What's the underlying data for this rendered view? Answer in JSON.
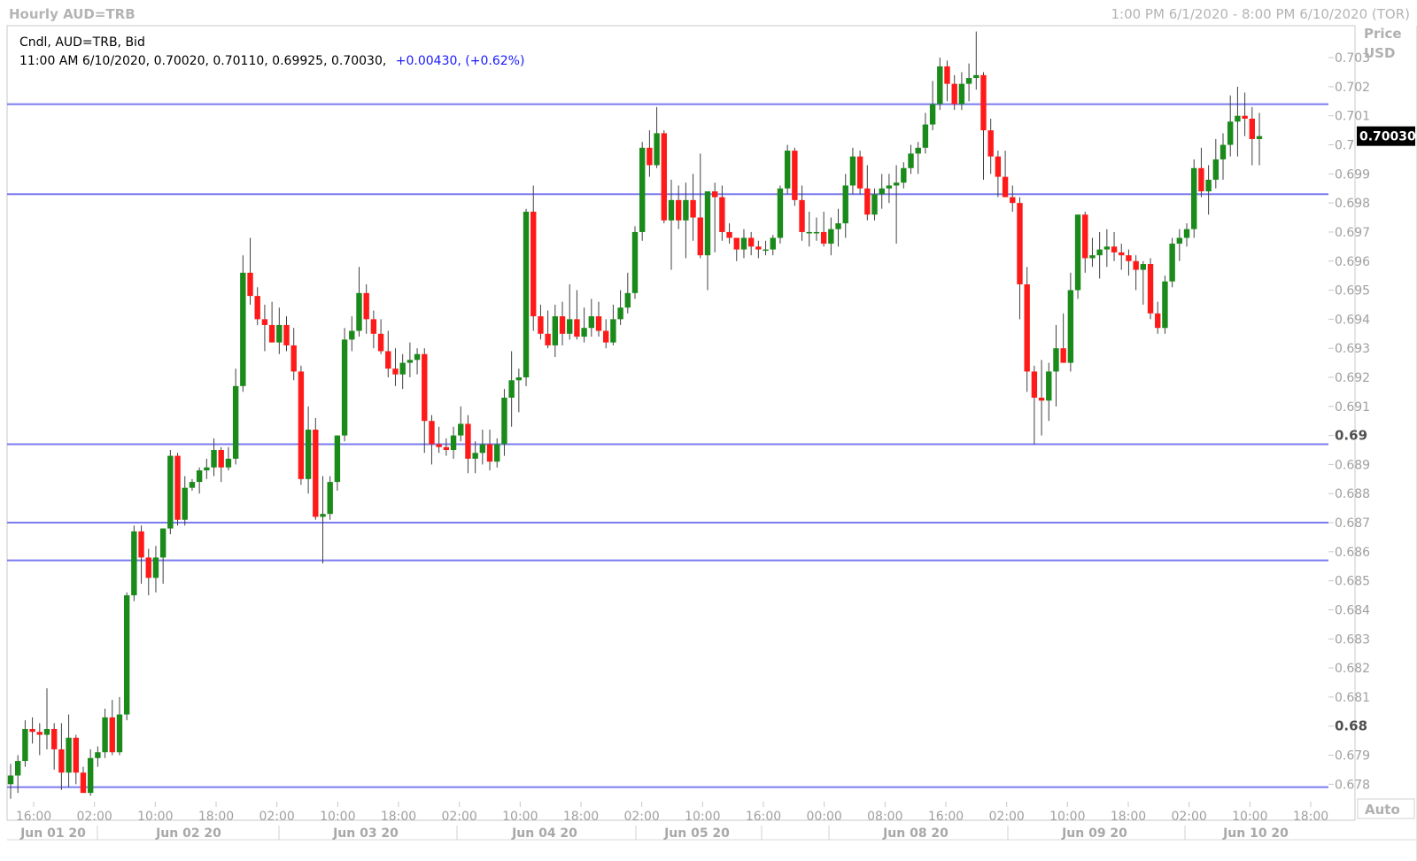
{
  "header": {
    "title": "Hourly AUD=TRB",
    "range": "1:00 PM 6/1/2020 - 8:00 PM 6/10/2020 (TOR)"
  },
  "legend": {
    "line1": "Cndl, AUD=TRB, Bid",
    "ohlc": "11:00 AM 6/10/2020, 0.70020, 0.70110, 0.69925, 0.70030,",
    "change": "+0.00430, (+0.62%)"
  },
  "price_axis": {
    "header_line1": "Price",
    "header_line2": "USD",
    "auto_label": "Auto",
    "last_price_label": "0.70030"
  },
  "colors": {
    "up": "#1a8a1a",
    "down": "#ff1a1a",
    "wick": "#404040",
    "hline": "#7b7bf0",
    "frame": "#c8c8c8"
  },
  "chart_data": {
    "type": "candlestick",
    "instrument": "AUD=TRB",
    "frequency": "Hourly",
    "ylim": [
      0.6774,
      0.7041
    ],
    "y_ticks": [
      {
        "v": 0.703,
        "label": "0.703"
      },
      {
        "v": 0.702,
        "label": "0.702"
      },
      {
        "v": 0.701,
        "label": "0.701"
      },
      {
        "v": 0.7,
        "label": "0.7"
      },
      {
        "v": 0.699,
        "label": "0.699"
      },
      {
        "v": 0.698,
        "label": "0.698"
      },
      {
        "v": 0.697,
        "label": "0.697"
      },
      {
        "v": 0.696,
        "label": "0.696"
      },
      {
        "v": 0.695,
        "label": "0.695"
      },
      {
        "v": 0.694,
        "label": "0.694"
      },
      {
        "v": 0.693,
        "label": "0.693"
      },
      {
        "v": 0.692,
        "label": "0.692"
      },
      {
        "v": 0.691,
        "label": "0.691"
      },
      {
        "v": 0.69,
        "label": "0.69",
        "bold": true
      },
      {
        "v": 0.689,
        "label": "0.689"
      },
      {
        "v": 0.688,
        "label": "0.688"
      },
      {
        "v": 0.687,
        "label": "0.687"
      },
      {
        "v": 0.686,
        "label": "0.686"
      },
      {
        "v": 0.685,
        "label": "0.685"
      },
      {
        "v": 0.684,
        "label": "0.684"
      },
      {
        "v": 0.683,
        "label": "0.683"
      },
      {
        "v": 0.682,
        "label": "0.682"
      },
      {
        "v": 0.681,
        "label": "0.681"
      },
      {
        "v": 0.68,
        "label": "0.68",
        "bold": true
      },
      {
        "v": 0.679,
        "label": "0.679"
      },
      {
        "v": 0.678,
        "label": "0.678"
      }
    ],
    "time_ticks": [
      "16:00",
      "02:00",
      "10:00",
      "18:00",
      "02:00",
      "10:00",
      "18:00",
      "02:00",
      "10:00",
      "18:00",
      "02:00",
      "10:00",
      "16:00",
      "00:00",
      "08:00",
      "16:00",
      "02:00",
      "10:00",
      "18:00",
      "02:00",
      "10:00",
      "18:00"
    ],
    "date_labels": [
      "Jun 01 20",
      "Jun 02 20",
      "Jun 03 20",
      "Jun 04 20",
      "Jun 05 20",
      "Jun 08 20",
      "Jun 09 20",
      "Jun 10 20"
    ],
    "horizontal_lines": [
      0.7014,
      0.6983,
      0.6897,
      0.687,
      0.6857,
      0.6779
    ],
    "candles": [
      [
        0.678,
        0.6787,
        0.6775,
        0.6783
      ],
      [
        0.6783,
        0.679,
        0.6777,
        0.6788
      ],
      [
        0.6788,
        0.6802,
        0.6786,
        0.6799
      ],
      [
        0.6799,
        0.6803,
        0.6794,
        0.6798
      ],
      [
        0.6798,
        0.6801,
        0.679,
        0.6797
      ],
      [
        0.6797,
        0.6813,
        0.6792,
        0.6799
      ],
      [
        0.6799,
        0.6801,
        0.6785,
        0.6792
      ],
      [
        0.6792,
        0.6801,
        0.6778,
        0.6784
      ],
      [
        0.6784,
        0.6804,
        0.6779,
        0.6796
      ],
      [
        0.6796,
        0.6797,
        0.678,
        0.6784
      ],
      [
        0.6784,
        0.6786,
        0.6777,
        0.6777
      ],
      [
        0.6777,
        0.6792,
        0.6776,
        0.6789
      ],
      [
        0.6789,
        0.6793,
        0.6786,
        0.6791
      ],
      [
        0.6791,
        0.6806,
        0.6789,
        0.6803
      ],
      [
        0.6803,
        0.6809,
        0.679,
        0.6791
      ],
      [
        0.6791,
        0.681,
        0.679,
        0.6804
      ],
      [
        0.6804,
        0.6846,
        0.6802,
        0.6845
      ],
      [
        0.6845,
        0.6869,
        0.6843,
        0.6867
      ],
      [
        0.6867,
        0.6869,
        0.6849,
        0.6858
      ],
      [
        0.6858,
        0.6861,
        0.6845,
        0.6851
      ],
      [
        0.6851,
        0.6862,
        0.6846,
        0.6858
      ],
      [
        0.6858,
        0.6868,
        0.6849,
        0.6868
      ],
      [
        0.6868,
        0.6895,
        0.6866,
        0.6893
      ],
      [
        0.6893,
        0.6894,
        0.6869,
        0.6871
      ],
      [
        0.6871,
        0.6886,
        0.6869,
        0.6882
      ],
      [
        0.6882,
        0.6885,
        0.6881,
        0.6884
      ],
      [
        0.6884,
        0.6889,
        0.688,
        0.6888
      ],
      [
        0.6888,
        0.6892,
        0.6885,
        0.6889
      ],
      [
        0.6889,
        0.6899,
        0.6886,
        0.6895
      ],
      [
        0.6895,
        0.6896,
        0.6884,
        0.6889
      ],
      [
        0.6889,
        0.6896,
        0.6888,
        0.6892
      ],
      [
        0.6892,
        0.6923,
        0.689,
        0.6917
      ],
      [
        0.6917,
        0.6962,
        0.6915,
        0.6956
      ],
      [
        0.6956,
        0.6968,
        0.6945,
        0.6948
      ],
      [
        0.6948,
        0.6951,
        0.6938,
        0.694
      ],
      [
        0.694,
        0.6945,
        0.6929,
        0.6938
      ],
      [
        0.6938,
        0.6946,
        0.6932,
        0.6932
      ],
      [
        0.6932,
        0.6944,
        0.6928,
        0.6938
      ],
      [
        0.6938,
        0.6941,
        0.6929,
        0.6931
      ],
      [
        0.6931,
        0.6937,
        0.6919,
        0.6922
      ],
      [
        0.6922,
        0.6924,
        0.6883,
        0.6885
      ],
      [
        0.6885,
        0.691,
        0.688,
        0.6902
      ],
      [
        0.6902,
        0.6906,
        0.6871,
        0.6872
      ],
      [
        0.6872,
        0.6886,
        0.6856,
        0.6873
      ],
      [
        0.6873,
        0.6886,
        0.6871,
        0.6884
      ],
      [
        0.6884,
        0.69,
        0.6881,
        0.69
      ],
      [
        0.69,
        0.6937,
        0.6898,
        0.6933
      ],
      [
        0.6933,
        0.6941,
        0.6929,
        0.6936
      ],
      [
        0.6936,
        0.6958,
        0.6934,
        0.6949
      ],
      [
        0.6949,
        0.6952,
        0.6935,
        0.694
      ],
      [
        0.694,
        0.6943,
        0.693,
        0.6935
      ],
      [
        0.6935,
        0.694,
        0.6928,
        0.6929
      ],
      [
        0.6929,
        0.6936,
        0.692,
        0.6923
      ],
      [
        0.6923,
        0.693,
        0.6917,
        0.6921
      ],
      [
        0.6921,
        0.6928,
        0.6916,
        0.6925
      ],
      [
        0.6925,
        0.6932,
        0.692,
        0.6926
      ],
      [
        0.6926,
        0.693,
        0.6921,
        0.6928
      ],
      [
        0.6928,
        0.693,
        0.6894,
        0.6905
      ],
      [
        0.6905,
        0.6907,
        0.689,
        0.6897
      ],
      [
        0.6897,
        0.6903,
        0.6894,
        0.6896
      ],
      [
        0.6896,
        0.6899,
        0.6893,
        0.6895
      ],
      [
        0.6895,
        0.6903,
        0.6892,
        0.69
      ],
      [
        0.69,
        0.691,
        0.6898,
        0.6904
      ],
      [
        0.6904,
        0.6907,
        0.6887,
        0.6892
      ],
      [
        0.6892,
        0.6898,
        0.6887,
        0.6894
      ],
      [
        0.6894,
        0.6902,
        0.689,
        0.6897
      ],
      [
        0.6897,
        0.6902,
        0.6888,
        0.6891
      ],
      [
        0.6891,
        0.6899,
        0.6889,
        0.6897
      ],
      [
        0.6897,
        0.6916,
        0.6893,
        0.6913
      ],
      [
        0.6913,
        0.6929,
        0.6903,
        0.6919
      ],
      [
        0.6919,
        0.6923,
        0.6908,
        0.692
      ],
      [
        0.692,
        0.6978,
        0.6917,
        0.6977
      ],
      [
        0.6977,
        0.6986,
        0.6936,
        0.6941
      ],
      [
        0.6941,
        0.6945,
        0.6933,
        0.6935
      ],
      [
        0.6935,
        0.6943,
        0.693,
        0.6931
      ],
      [
        0.6931,
        0.6945,
        0.6927,
        0.6941
      ],
      [
        0.6941,
        0.6946,
        0.6931,
        0.6935
      ],
      [
        0.6935,
        0.6952,
        0.6933,
        0.694
      ],
      [
        0.694,
        0.695,
        0.6933,
        0.6934
      ],
      [
        0.6934,
        0.6944,
        0.6932,
        0.6937
      ],
      [
        0.6937,
        0.6947,
        0.6934,
        0.6941
      ],
      [
        0.6941,
        0.6946,
        0.6934,
        0.6936
      ],
      [
        0.6936,
        0.694,
        0.693,
        0.6932
      ],
      [
        0.6932,
        0.6945,
        0.6931,
        0.694
      ],
      [
        0.694,
        0.695,
        0.6938,
        0.6944
      ],
      [
        0.6944,
        0.6956,
        0.6942,
        0.6949
      ],
      [
        0.6949,
        0.6972,
        0.6947,
        0.697
      ],
      [
        0.697,
        0.7001,
        0.6967,
        0.6999
      ],
      [
        0.6999,
        0.7005,
        0.6989,
        0.6993
      ],
      [
        0.6993,
        0.7013,
        0.6992,
        0.7004
      ],
      [
        0.7004,
        0.7005,
        0.6973,
        0.6974
      ],
      [
        0.6974,
        0.6988,
        0.6957,
        0.6981
      ],
      [
        0.6981,
        0.6986,
        0.6971,
        0.6974
      ],
      [
        0.6974,
        0.6987,
        0.6961,
        0.6981
      ],
      [
        0.6981,
        0.699,
        0.6967,
        0.6975
      ],
      [
        0.6975,
        0.6997,
        0.6961,
        0.6962
      ],
      [
        0.6962,
        0.6983,
        0.695,
        0.6984
      ],
      [
        0.6984,
        0.6987,
        0.6963,
        0.6982
      ],
      [
        0.6982,
        0.6986,
        0.6967,
        0.697
      ],
      [
        0.697,
        0.6973,
        0.6966,
        0.6968
      ],
      [
        0.6968,
        0.6968,
        0.696,
        0.6964
      ],
      [
        0.6964,
        0.6971,
        0.6961,
        0.6968
      ],
      [
        0.6968,
        0.697,
        0.6962,
        0.6965
      ],
      [
        0.6965,
        0.6967,
        0.6961,
        0.6964
      ],
      [
        0.6964,
        0.6967,
        0.6962,
        0.6964
      ],
      [
        0.6964,
        0.6969,
        0.6962,
        0.6968
      ],
      [
        0.6968,
        0.6986,
        0.6966,
        0.6985
      ],
      [
        0.6985,
        0.7,
        0.6983,
        0.6998
      ],
      [
        0.6998,
        0.6999,
        0.6979,
        0.6981
      ],
      [
        0.6981,
        0.6986,
        0.6967,
        0.697
      ],
      [
        0.697,
        0.6977,
        0.6965,
        0.697
      ],
      [
        0.697,
        0.6975,
        0.6967,
        0.697
      ],
      [
        0.697,
        0.6977,
        0.6965,
        0.6966
      ],
      [
        0.6966,
        0.6975,
        0.6962,
        0.6971
      ],
      [
        0.6971,
        0.6978,
        0.6965,
        0.6973
      ],
      [
        0.6973,
        0.699,
        0.6968,
        0.6986
      ],
      [
        0.6986,
        0.6999,
        0.6983,
        0.6996
      ],
      [
        0.6996,
        0.6998,
        0.6983,
        0.6985
      ],
      [
        0.6985,
        0.6993,
        0.6974,
        0.6976
      ],
      [
        0.6976,
        0.6985,
        0.6974,
        0.6983
      ],
      [
        0.6983,
        0.699,
        0.6978,
        0.6985
      ],
      [
        0.6985,
        0.699,
        0.698,
        0.6986
      ],
      [
        0.6986,
        0.6993,
        0.6966,
        0.6987
      ],
      [
        0.6987,
        0.6994,
        0.6985,
        0.6992
      ],
      [
        0.6992,
        0.7,
        0.699,
        0.6997
      ],
      [
        0.6997,
        0.7001,
        0.699,
        0.6999
      ],
      [
        0.6999,
        0.7011,
        0.6997,
        0.7007
      ],
      [
        0.7007,
        0.7022,
        0.7005,
        0.7014
      ],
      [
        0.7014,
        0.703,
        0.7012,
        0.7027
      ],
      [
        0.7027,
        0.7029,
        0.7015,
        0.7021
      ],
      [
        0.7021,
        0.7024,
        0.7012,
        0.7014
      ],
      [
        0.7014,
        0.7025,
        0.7012,
        0.7021
      ],
      [
        0.7021,
        0.7028,
        0.7015,
        0.7023
      ],
      [
        0.7023,
        0.7039,
        0.7019,
        0.7024
      ],
      [
        0.7024,
        0.7025,
        0.6988,
        0.7005
      ],
      [
        0.7005,
        0.7009,
        0.699,
        0.6996
      ],
      [
        0.6996,
        0.6998,
        0.6982,
        0.6989
      ],
      [
        0.6989,
        0.6998,
        0.6985,
        0.6982
      ],
      [
        0.6982,
        0.6986,
        0.6977,
        0.698
      ],
      [
        0.698,
        0.6982,
        0.694,
        0.6952
      ],
      [
        0.6952,
        0.6958,
        0.6915,
        0.6922
      ],
      [
        0.6922,
        0.6924,
        0.6897,
        0.6913
      ],
      [
        0.6913,
        0.6926,
        0.69,
        0.6912
      ],
      [
        0.6912,
        0.6925,
        0.6905,
        0.6922
      ],
      [
        0.6922,
        0.6938,
        0.691,
        0.693
      ],
      [
        0.693,
        0.6942,
        0.6925,
        0.6925
      ],
      [
        0.6925,
        0.6956,
        0.6922,
        0.695
      ],
      [
        0.695,
        0.6976,
        0.6947,
        0.6976
      ],
      [
        0.6976,
        0.6977,
        0.6956,
        0.6961
      ],
      [
        0.6961,
        0.6968,
        0.6958,
        0.6962
      ],
      [
        0.6962,
        0.697,
        0.6954,
        0.6964
      ],
      [
        0.6964,
        0.6971,
        0.6958,
        0.6965
      ],
      [
        0.6965,
        0.697,
        0.696,
        0.6963
      ],
      [
        0.6963,
        0.6966,
        0.6957,
        0.6962
      ],
      [
        0.6962,
        0.6964,
        0.6955,
        0.696
      ],
      [
        0.696,
        0.6962,
        0.695,
        0.6957
      ],
      [
        0.6957,
        0.696,
        0.6945,
        0.6959
      ],
      [
        0.6959,
        0.6961,
        0.694,
        0.6942
      ],
      [
        0.6942,
        0.6946,
        0.6935,
        0.6937
      ],
      [
        0.6937,
        0.6955,
        0.6935,
        0.6953
      ],
      [
        0.6953,
        0.6968,
        0.6951,
        0.6966
      ],
      [
        0.6966,
        0.6971,
        0.696,
        0.6968
      ],
      [
        0.6968,
        0.6973,
        0.6965,
        0.6971
      ],
      [
        0.6971,
        0.6995,
        0.6968,
        0.6992
      ],
      [
        0.6992,
        0.6999,
        0.6982,
        0.6984
      ],
      [
        0.6984,
        0.6993,
        0.6976,
        0.6988
      ],
      [
        0.6988,
        0.7002,
        0.6985,
        0.6995
      ],
      [
        0.6995,
        0.7004,
        0.6988,
        0.7
      ],
      [
        0.7,
        0.7017,
        0.6996,
        0.7008
      ],
      [
        0.7008,
        0.702,
        0.6996,
        0.701
      ],
      [
        0.701,
        0.7018,
        0.7003,
        0.7009
      ],
      [
        0.7009,
        0.7013,
        0.6993,
        0.7002
      ],
      [
        0.7002,
        0.7011,
        0.6993,
        0.7003
      ]
    ]
  }
}
